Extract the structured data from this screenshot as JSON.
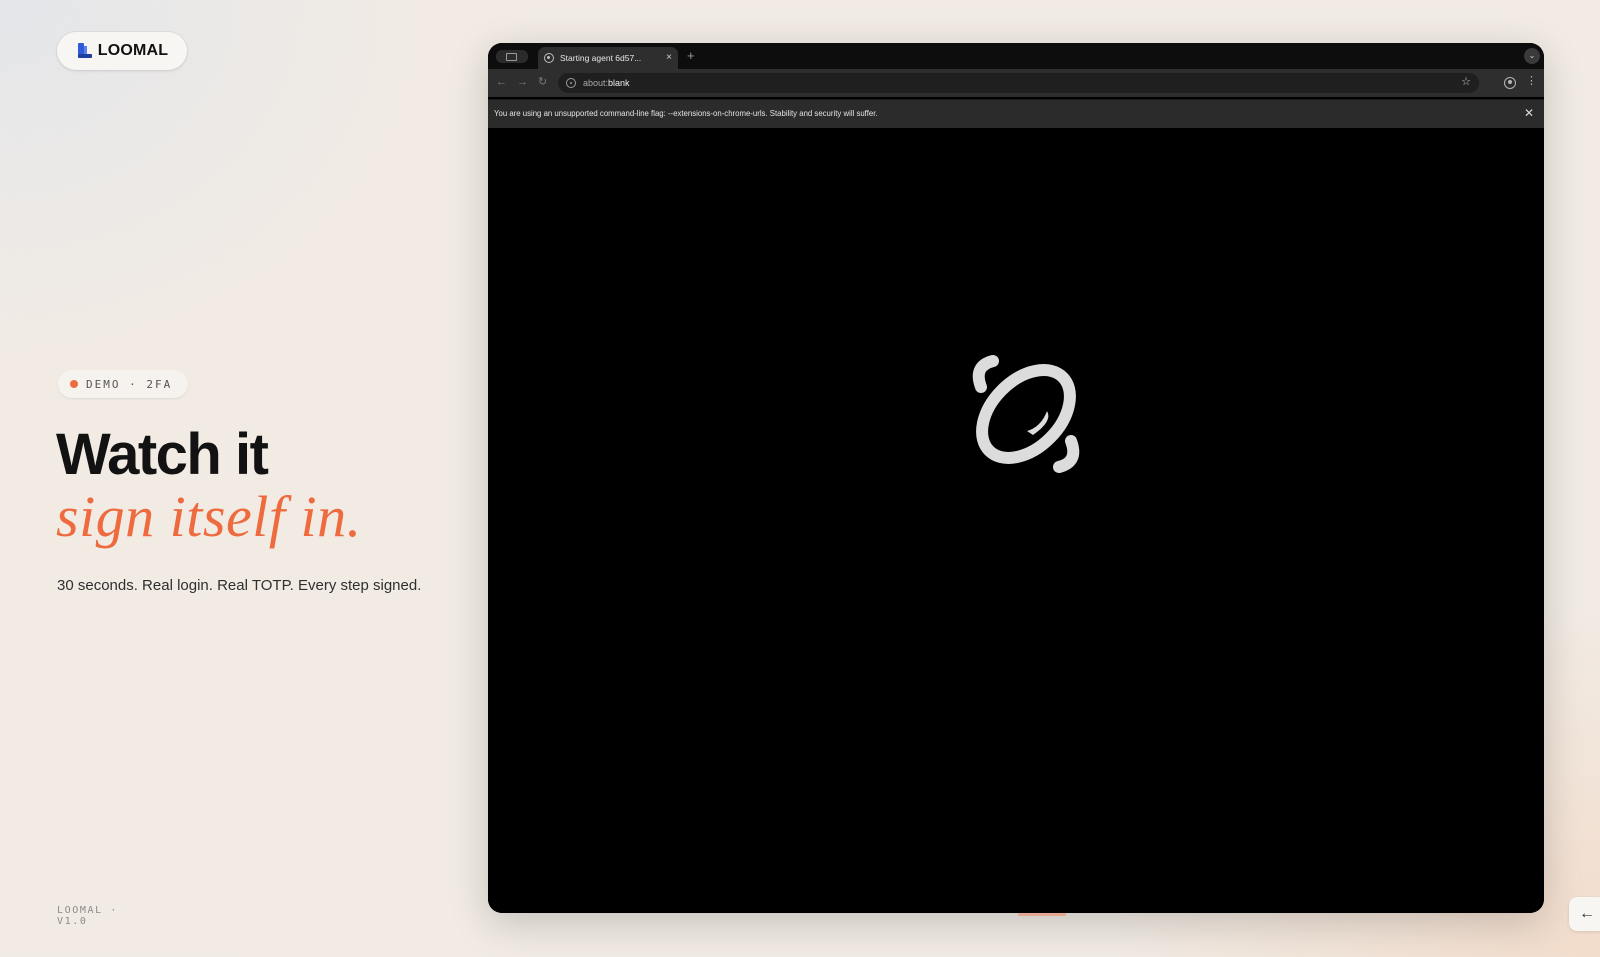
{
  "brand": {
    "name": "LOOMAL",
    "icon": "looma-logo-icon",
    "accent": "#ee6b3f"
  },
  "badge": {
    "text": "DEMO · 2FA",
    "dot_color": "#ee6b3f"
  },
  "hero": {
    "headline": "Watch it",
    "headline_accent": "sign itself in.",
    "subtitle": "30 seconds. Real login. Real TOTP. Every step signed."
  },
  "footer": {
    "version_line1": "LOOMAL ·",
    "version_line2": "V1.0"
  },
  "browser": {
    "tab": {
      "title": "Starting agent 6d57...",
      "close": "×",
      "favicon": "globe-icon"
    },
    "new_tab": "+",
    "tab_menu": "⌄",
    "nav": {
      "back": "←",
      "forward": "→",
      "reload": "↻"
    },
    "address": {
      "scheme": "about:",
      "host": "blank"
    },
    "bookmark": "☆",
    "menu": "⋮",
    "infobar": {
      "text": "You are using an unsupported command-line flag: --extensions-on-chrome-urls. Stability and security will suffer.",
      "close": "✕"
    },
    "viewport": {
      "content_icon": "agent-loading-logo-icon",
      "background": "#000000"
    }
  },
  "controls": {
    "back_arrow": "←"
  }
}
